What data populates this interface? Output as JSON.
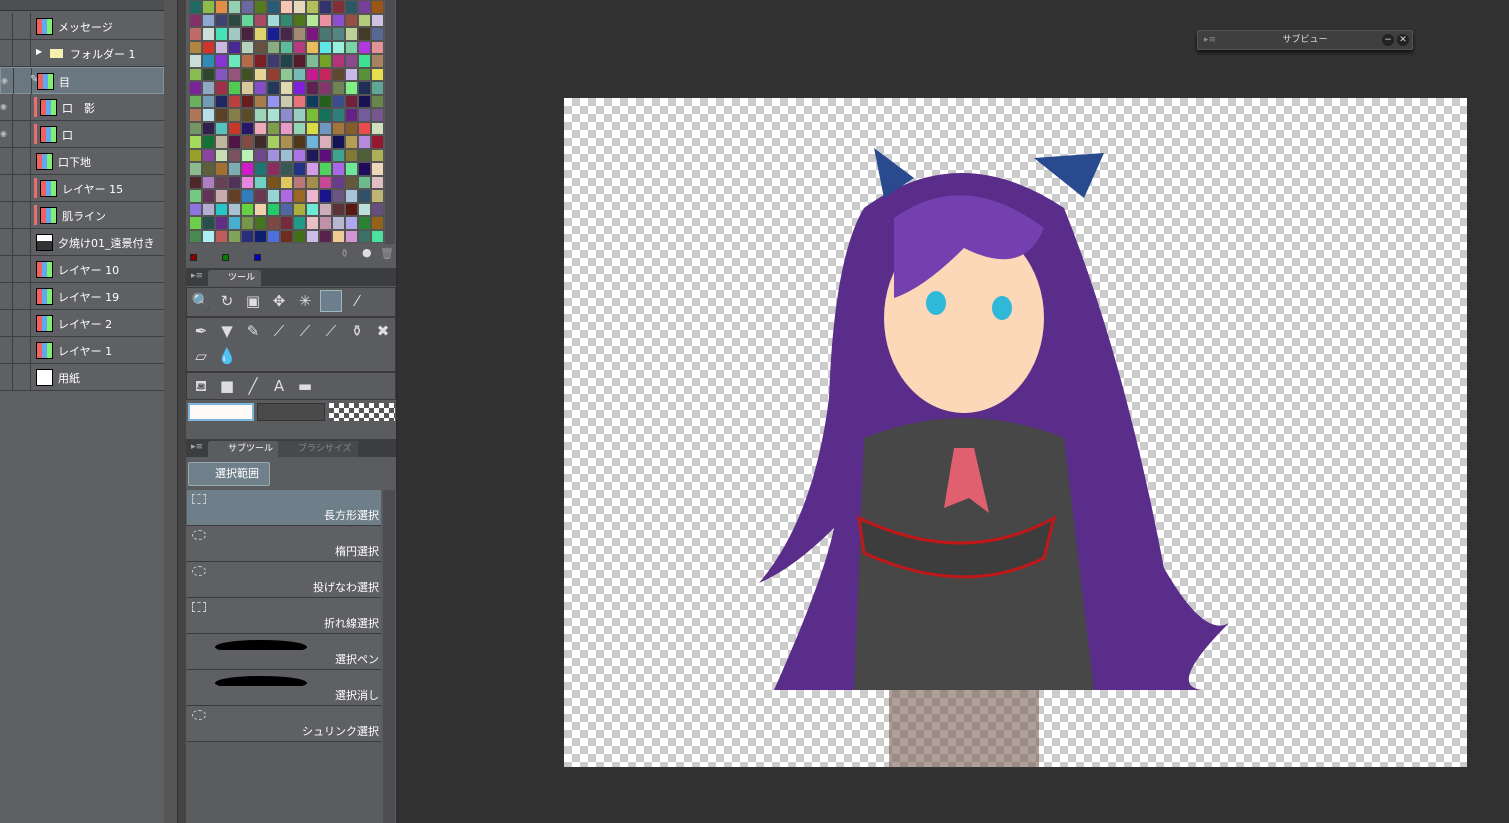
{
  "layers": [
    {
      "name": "メッセージ",
      "type": "raster",
      "clip": false
    },
    {
      "name": "フォルダー 1",
      "type": "folder",
      "clip": false
    },
    {
      "name": "目",
      "type": "raster",
      "clip": false,
      "selected": true,
      "visible": true,
      "editing": true
    },
    {
      "name": "口　影",
      "type": "raster",
      "clip": true,
      "visible": true
    },
    {
      "name": "口",
      "type": "raster",
      "clip": true,
      "visible": true
    },
    {
      "name": "口下地",
      "type": "raster",
      "clip": false
    },
    {
      "name": "レイヤー 15",
      "type": "raster",
      "clip": true
    },
    {
      "name": "肌ライン",
      "type": "raster",
      "clip": true
    },
    {
      "name": "夕焼け01_遠景付き",
      "type": "photo",
      "clip": false
    },
    {
      "name": "レイヤー 10",
      "type": "raster",
      "clip": false
    },
    {
      "name": "レイヤー 19",
      "type": "raster",
      "clip": false
    },
    {
      "name": "レイヤー 2",
      "type": "raster",
      "clip": false
    },
    {
      "name": "レイヤー 1",
      "type": "raster",
      "clip": false
    },
    {
      "name": "用紙",
      "type": "paper",
      "clip": false
    }
  ],
  "color_sets": {
    "swatches": [
      "#8b0000",
      "#008000",
      "#0000c0"
    ]
  },
  "tool_panel": {
    "tab": "ツール",
    "tools": [
      "zoom-icon",
      "rotate-icon",
      "object-icon",
      "move-icon",
      "magic-wand-icon",
      "selection-icon",
      "eyedropper-icon",
      "pen-icon",
      "marker-icon",
      "pencil-icon",
      "brush-icon",
      "airbrush-icon",
      "blend-icon",
      "ink-icon",
      "decoration-icon",
      "eraser-icon",
      "fluid-icon",
      "fill-icon",
      "gradient-icon",
      "line-icon",
      "text-icon",
      "balloon-icon"
    ],
    "selected": "selection-icon"
  },
  "subtool_panel": {
    "tab": "サブツール",
    "tab2": "ブラシサイズ",
    "group": "選択範囲",
    "items": [
      {
        "label": "長方形選択",
        "selected": true
      },
      {
        "label": "楕円選択"
      },
      {
        "label": "投げなわ選択"
      },
      {
        "label": "折れ線選択"
      },
      {
        "label": "選択ペン"
      },
      {
        "label": "選択消し"
      },
      {
        "label": "シュリンク選択"
      }
    ]
  },
  "subview": {
    "title": "サブビュー"
  }
}
